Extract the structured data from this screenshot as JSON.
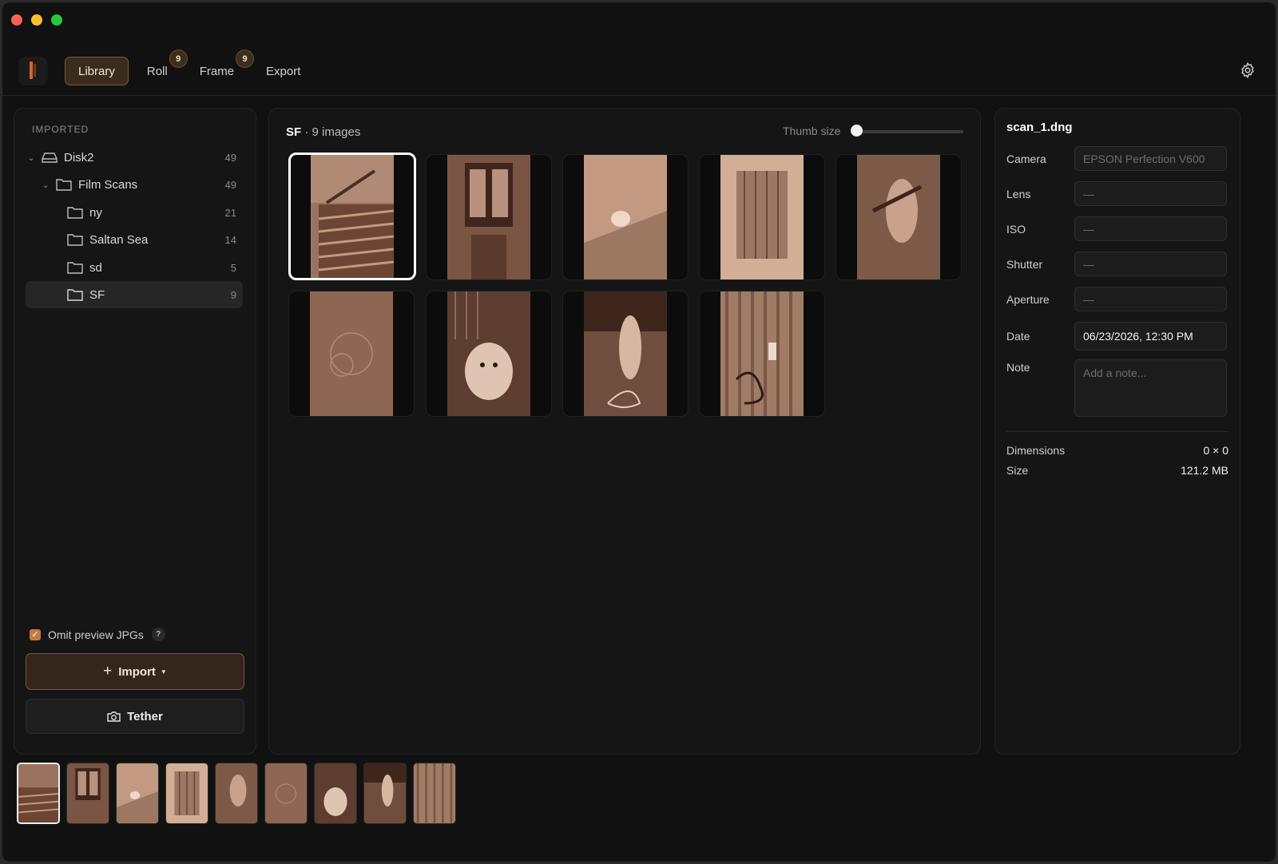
{
  "nav": {
    "tabs": [
      {
        "label": "Library",
        "badge": ""
      },
      {
        "label": "Roll",
        "badge": "9"
      },
      {
        "label": "Frame",
        "badge": "9"
      },
      {
        "label": "Export",
        "badge": ""
      }
    ]
  },
  "sidebar": {
    "section_title": "IMPORTED",
    "tree": [
      {
        "label": "Disk2",
        "count": "49"
      },
      {
        "label": "Film Scans",
        "count": "49"
      },
      {
        "label": "ny",
        "count": "21"
      },
      {
        "label": "Saltan Sea",
        "count": "14"
      },
      {
        "label": "sd",
        "count": "5"
      },
      {
        "label": "SF",
        "count": "9"
      }
    ],
    "omit_label": "Omit preview JPGs",
    "help_glyph": "?",
    "import_label": "Import",
    "tether_label": "Tether"
  },
  "gallery": {
    "folder": "SF",
    "count_text": "· 9 images",
    "thumb_size_label": "Thumb size",
    "thumb_size_level": 0
  },
  "info": {
    "file_name": "scan_1.dng",
    "fields": [
      {
        "label": "Camera",
        "value": "EPSON Perfection V600"
      },
      {
        "label": "Lens",
        "value": "—"
      },
      {
        "label": "ISO",
        "value": "—"
      },
      {
        "label": "Shutter",
        "value": "—"
      },
      {
        "label": "Aperture",
        "value": "—"
      },
      {
        "label": "Date",
        "value": "06/23/2026, 12:30 PM"
      }
    ],
    "note_label": "Note",
    "note_placeholder": "Add a note...",
    "dimensions_label": "Dimensions",
    "dimensions_value": "0 × 0",
    "size_label": "Size",
    "size_value": "121.2 MB"
  },
  "colors": {
    "accent": "#c27a44",
    "accent_dark": "#34261a",
    "film_tone": "#8a6450"
  }
}
